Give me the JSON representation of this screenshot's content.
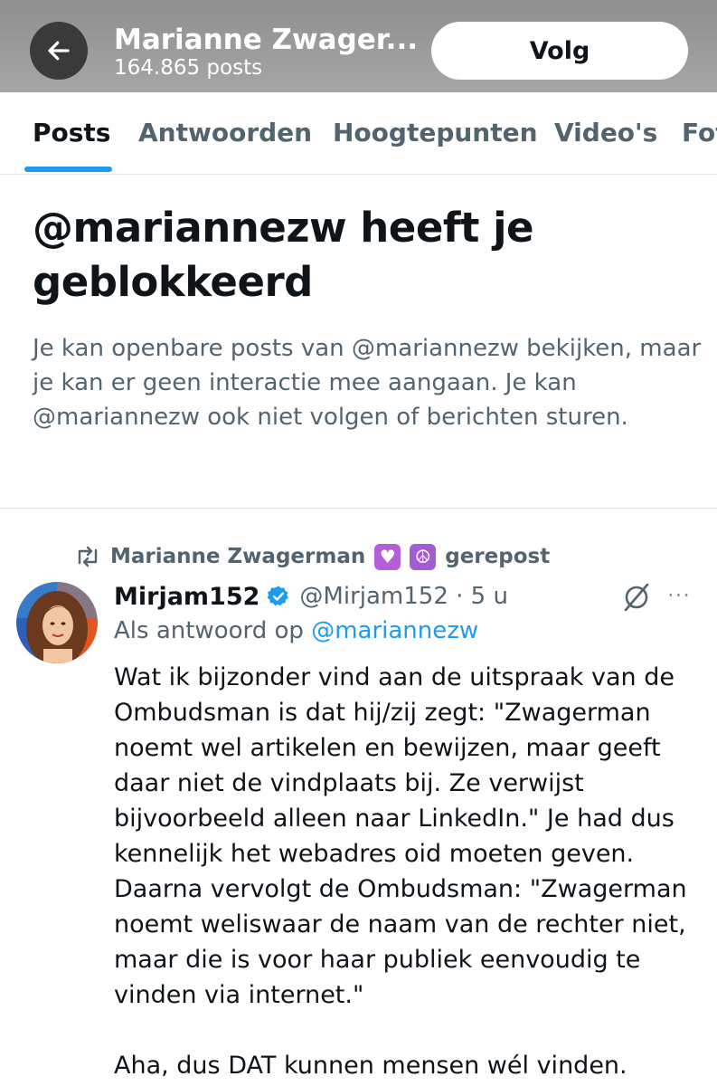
{
  "header": {
    "name": "Marianne Zwager...",
    "post_count": "164.865 posts",
    "follow_label": "Volg"
  },
  "tabs": [
    {
      "label": "Posts",
      "active": true
    },
    {
      "label": "Antwoorden",
      "active": false
    },
    {
      "label": "Hoogtepunten",
      "active": false
    },
    {
      "label": "Video's",
      "active": false
    },
    {
      "label": "Fot",
      "active": false
    }
  ],
  "blocked": {
    "title": "@mariannezw heeft je geblokkeerd",
    "description": "Je kan openbare posts van @mariannezw bekijken, maar je kan er geen interactie mee aangaan. Je kan @mariannezw ook niet volgen of berichten sturen."
  },
  "post": {
    "repost_by": "Marianne Zwagerman",
    "repost_emoji_1": "♥",
    "repost_emoji_2": "☮",
    "repost_suffix": "gerepost",
    "author_name": "Mirjam152",
    "author_handle": "@Mirjam152 · 5 u",
    "reply_prefix": "Als antwoord op",
    "reply_mention": "@mariannezw",
    "body_paragraphs": [
      "Wat ik bijzonder vind aan de uitspraak van de Ombudsman is dat hij/zij zegt: \"Zwagerman noemt wel artikelen en bewijzen, maar geeft daar niet de vindplaats bij. Ze verwijst bijvoorbeeld alleen naar LinkedIn.\" Je had dus kennelijk het webadres oid moeten geven. Daarna vervolgt de Ombudsman: \"Zwagerman noemt weliswaar de naam van de rechter niet, maar die is voor haar publiek eenvoudig te vinden via internet.\"",
      "Aha, dus DAT kunnen mensen wél vinden."
    ],
    "more_glyph": "···"
  },
  "colors": {
    "accent": "#1d9bf0",
    "secondary_text": "#536471",
    "primary_text": "#0f1419",
    "header_bg": "#9a9a9a"
  },
  "icons": [
    "back-arrow-icon",
    "repost-icon",
    "verified-badge-icon",
    "grok-icon",
    "more-icon"
  ]
}
